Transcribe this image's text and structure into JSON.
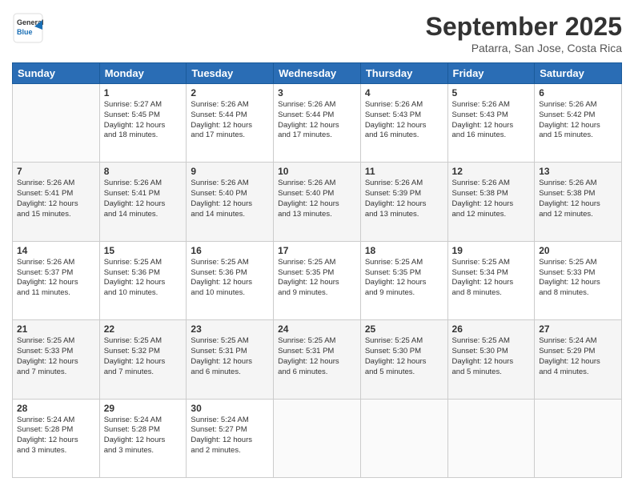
{
  "logo": {
    "general": "General",
    "blue": "Blue"
  },
  "header": {
    "month": "September 2025",
    "location": "Patarra, San Jose, Costa Rica"
  },
  "weekdays": [
    "Sunday",
    "Monday",
    "Tuesday",
    "Wednesday",
    "Thursday",
    "Friday",
    "Saturday"
  ],
  "weeks": [
    [
      {
        "day": "",
        "info": ""
      },
      {
        "day": "1",
        "info": "Sunrise: 5:27 AM\nSunset: 5:45 PM\nDaylight: 12 hours\nand 18 minutes."
      },
      {
        "day": "2",
        "info": "Sunrise: 5:26 AM\nSunset: 5:44 PM\nDaylight: 12 hours\nand 17 minutes."
      },
      {
        "day": "3",
        "info": "Sunrise: 5:26 AM\nSunset: 5:44 PM\nDaylight: 12 hours\nand 17 minutes."
      },
      {
        "day": "4",
        "info": "Sunrise: 5:26 AM\nSunset: 5:43 PM\nDaylight: 12 hours\nand 16 minutes."
      },
      {
        "day": "5",
        "info": "Sunrise: 5:26 AM\nSunset: 5:43 PM\nDaylight: 12 hours\nand 16 minutes."
      },
      {
        "day": "6",
        "info": "Sunrise: 5:26 AM\nSunset: 5:42 PM\nDaylight: 12 hours\nand 15 minutes."
      }
    ],
    [
      {
        "day": "7",
        "info": "Sunrise: 5:26 AM\nSunset: 5:41 PM\nDaylight: 12 hours\nand 15 minutes."
      },
      {
        "day": "8",
        "info": "Sunrise: 5:26 AM\nSunset: 5:41 PM\nDaylight: 12 hours\nand 14 minutes."
      },
      {
        "day": "9",
        "info": "Sunrise: 5:26 AM\nSunset: 5:40 PM\nDaylight: 12 hours\nand 14 minutes."
      },
      {
        "day": "10",
        "info": "Sunrise: 5:26 AM\nSunset: 5:40 PM\nDaylight: 12 hours\nand 13 minutes."
      },
      {
        "day": "11",
        "info": "Sunrise: 5:26 AM\nSunset: 5:39 PM\nDaylight: 12 hours\nand 13 minutes."
      },
      {
        "day": "12",
        "info": "Sunrise: 5:26 AM\nSunset: 5:38 PM\nDaylight: 12 hours\nand 12 minutes."
      },
      {
        "day": "13",
        "info": "Sunrise: 5:26 AM\nSunset: 5:38 PM\nDaylight: 12 hours\nand 12 minutes."
      }
    ],
    [
      {
        "day": "14",
        "info": "Sunrise: 5:26 AM\nSunset: 5:37 PM\nDaylight: 12 hours\nand 11 minutes."
      },
      {
        "day": "15",
        "info": "Sunrise: 5:25 AM\nSunset: 5:36 PM\nDaylight: 12 hours\nand 10 minutes."
      },
      {
        "day": "16",
        "info": "Sunrise: 5:25 AM\nSunset: 5:36 PM\nDaylight: 12 hours\nand 10 minutes."
      },
      {
        "day": "17",
        "info": "Sunrise: 5:25 AM\nSunset: 5:35 PM\nDaylight: 12 hours\nand 9 minutes."
      },
      {
        "day": "18",
        "info": "Sunrise: 5:25 AM\nSunset: 5:35 PM\nDaylight: 12 hours\nand 9 minutes."
      },
      {
        "day": "19",
        "info": "Sunrise: 5:25 AM\nSunset: 5:34 PM\nDaylight: 12 hours\nand 8 minutes."
      },
      {
        "day": "20",
        "info": "Sunrise: 5:25 AM\nSunset: 5:33 PM\nDaylight: 12 hours\nand 8 minutes."
      }
    ],
    [
      {
        "day": "21",
        "info": "Sunrise: 5:25 AM\nSunset: 5:33 PM\nDaylight: 12 hours\nand 7 minutes."
      },
      {
        "day": "22",
        "info": "Sunrise: 5:25 AM\nSunset: 5:32 PM\nDaylight: 12 hours\nand 7 minutes."
      },
      {
        "day": "23",
        "info": "Sunrise: 5:25 AM\nSunset: 5:31 PM\nDaylight: 12 hours\nand 6 minutes."
      },
      {
        "day": "24",
        "info": "Sunrise: 5:25 AM\nSunset: 5:31 PM\nDaylight: 12 hours\nand 6 minutes."
      },
      {
        "day": "25",
        "info": "Sunrise: 5:25 AM\nSunset: 5:30 PM\nDaylight: 12 hours\nand 5 minutes."
      },
      {
        "day": "26",
        "info": "Sunrise: 5:25 AM\nSunset: 5:30 PM\nDaylight: 12 hours\nand 5 minutes."
      },
      {
        "day": "27",
        "info": "Sunrise: 5:24 AM\nSunset: 5:29 PM\nDaylight: 12 hours\nand 4 minutes."
      }
    ],
    [
      {
        "day": "28",
        "info": "Sunrise: 5:24 AM\nSunset: 5:28 PM\nDaylight: 12 hours\nand 3 minutes."
      },
      {
        "day": "29",
        "info": "Sunrise: 5:24 AM\nSunset: 5:28 PM\nDaylight: 12 hours\nand 3 minutes."
      },
      {
        "day": "30",
        "info": "Sunrise: 5:24 AM\nSunset: 5:27 PM\nDaylight: 12 hours\nand 2 minutes."
      },
      {
        "day": "",
        "info": ""
      },
      {
        "day": "",
        "info": ""
      },
      {
        "day": "",
        "info": ""
      },
      {
        "day": "",
        "info": ""
      }
    ]
  ]
}
